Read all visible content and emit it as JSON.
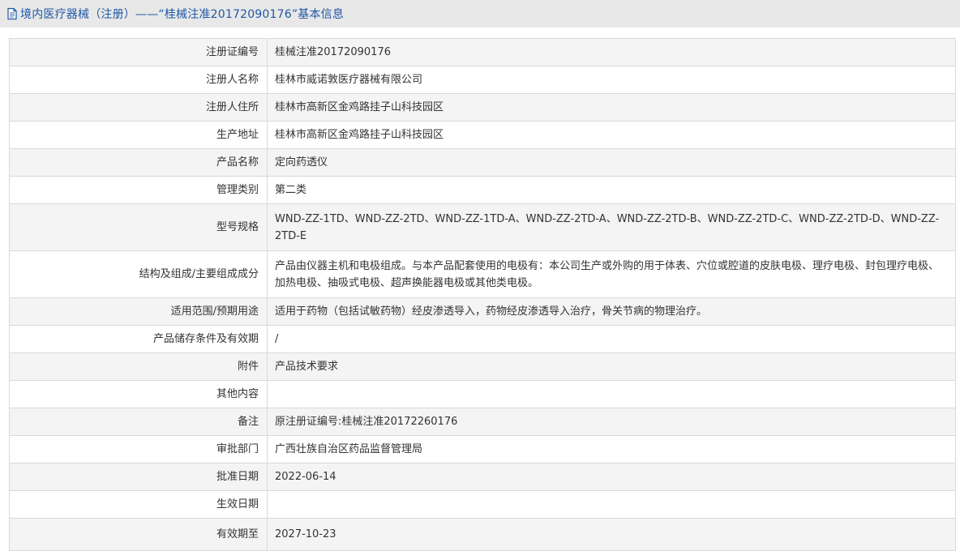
{
  "header": {
    "title": "境内医疗器械（注册）——“桂械注准20172090176”基本信息",
    "icon": "document-icon",
    "title_color": "#1f57a4"
  },
  "detail_rows": [
    {
      "label": "注册证编号",
      "value": "桂械注准20172090176"
    },
    {
      "label": "注册人名称",
      "value": "桂林市威诺敦医疗器械有限公司"
    },
    {
      "label": "注册人住所",
      "value": "桂林市高新区金鸡路挂子山科技园区"
    },
    {
      "label": "生产地址",
      "value": "桂林市高新区金鸡路挂子山科技园区"
    },
    {
      "label": "产品名称",
      "value": "定向药透仪"
    },
    {
      "label": "管理类别",
      "value": "第二类"
    },
    {
      "label": "型号规格",
      "value": "WND-ZZ-1TD、WND-ZZ-2TD、WND-ZZ-1TD-A、WND-ZZ-2TD-A、WND-ZZ-2TD-B、WND-ZZ-2TD-C、WND-ZZ-2TD-D、WND-ZZ-2TD-E"
    },
    {
      "label": "结构及组成/主要组成成分",
      "value": "产品由仪器主机和电极组成。与本产品配套使用的电极有：本公司生产或外购的用于体表、穴位或腔道的皮肤电极、理疗电极、封包理疗电极、加热电极、抽吸式电极、超声换能器电极或其他类电极。"
    },
    {
      "label": "适用范围/预期用途",
      "value": "适用于药物（包括试敏药物）经皮渗透导入，药物经皮渗透导入治疗，骨关节病的物理治疗。"
    },
    {
      "label": "产品储存条件及有效期",
      "value": "/"
    },
    {
      "label": "附件",
      "value": "产品技术要求"
    },
    {
      "label": "其他内容",
      "value": ""
    },
    {
      "label": "备注",
      "value": "原注册证编号:桂械注准20172260176"
    },
    {
      "label": "审批部门",
      "value": "广西壮族自治区药品监督管理局"
    },
    {
      "label": "批准日期",
      "value": "2022-06-14"
    },
    {
      "label": "生效日期",
      "value": ""
    },
    {
      "label": "有效期至",
      "value": "2027-10-23"
    }
  ]
}
